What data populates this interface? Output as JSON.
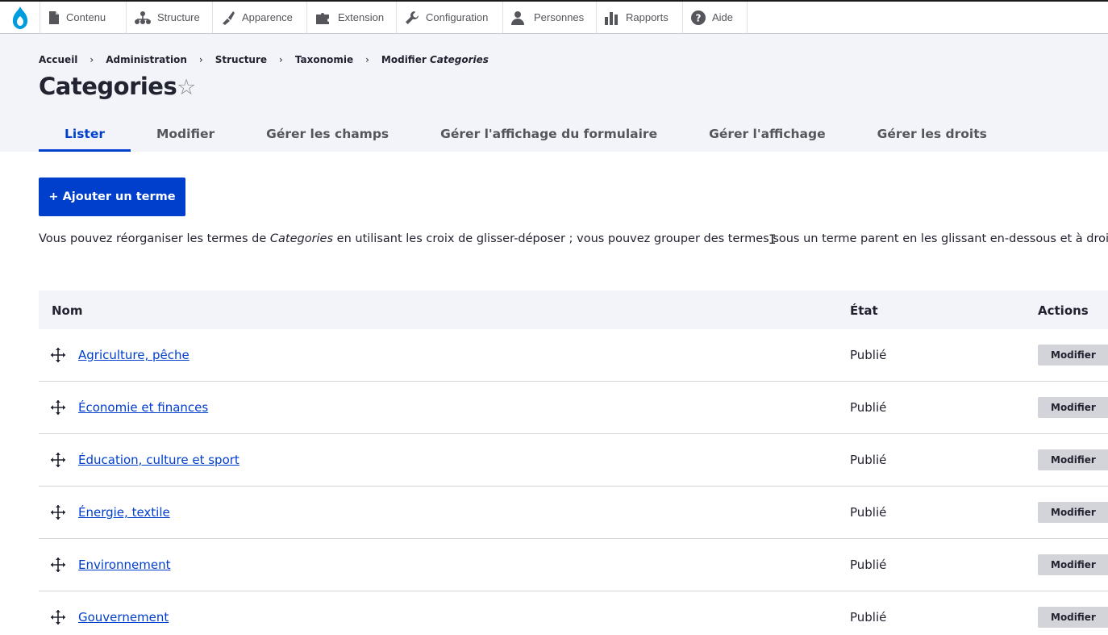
{
  "toolbar": {
    "items": [
      {
        "label": "Contenu",
        "icon": "file-icon"
      },
      {
        "label": "Structure",
        "icon": "sitemap-icon"
      },
      {
        "label": "Apparence",
        "icon": "brush-icon"
      },
      {
        "label": "Extension",
        "icon": "puzzle-icon"
      },
      {
        "label": "Configuration",
        "icon": "wrench-icon"
      },
      {
        "label": "Personnes",
        "icon": "person-icon"
      },
      {
        "label": "Rapports",
        "icon": "chart-icon"
      },
      {
        "label": "Aide",
        "icon": "help-icon"
      }
    ]
  },
  "breadcrumb": {
    "items": [
      "Accueil",
      "Administration",
      "Structure",
      "Taxonomie"
    ],
    "current_prefix": "Modifier",
    "current_name": "Categories"
  },
  "page": {
    "title": "Categories"
  },
  "tabs": [
    {
      "label": "Lister",
      "active": true
    },
    {
      "label": "Modifier",
      "active": false
    },
    {
      "label": "Gérer les champs",
      "active": false
    },
    {
      "label": "Gérer l'affichage du formulaire",
      "active": false
    },
    {
      "label": "Gérer l'affichage",
      "active": false
    },
    {
      "label": "Gérer les droits",
      "active": false
    }
  ],
  "add_button": "+ Ajouter un terme",
  "help": {
    "before": "Vous pouvez réorganiser les termes de ",
    "vocab": "Categories",
    "after": " en utilisant les croix de glisser-déposer ; vous pouvez grouper des termes sous un terme parent en les glissant en-dessous et à droite du p"
  },
  "table": {
    "headers": {
      "name": "Nom",
      "state": "État",
      "actions": "Actions"
    },
    "rows": [
      {
        "name": "Agriculture, pêche",
        "state": "Publié",
        "action": "Modifier"
      },
      {
        "name": "Économie et finances",
        "state": "Publié",
        "action": "Modifier"
      },
      {
        "name": "Éducation, culture et sport",
        "state": "Publié",
        "action": "Modifier"
      },
      {
        "name": "Énergie, textile",
        "state": "Publié",
        "action": "Modifier"
      },
      {
        "name": "Environnement",
        "state": "Publié",
        "action": "Modifier"
      },
      {
        "name": "Gouvernement",
        "state": "Publié",
        "action": "Modifier"
      }
    ]
  },
  "colors": {
    "accent": "#003ecc",
    "header_bg": "#f3f4f9",
    "button_gray": "#d3d4d9"
  }
}
